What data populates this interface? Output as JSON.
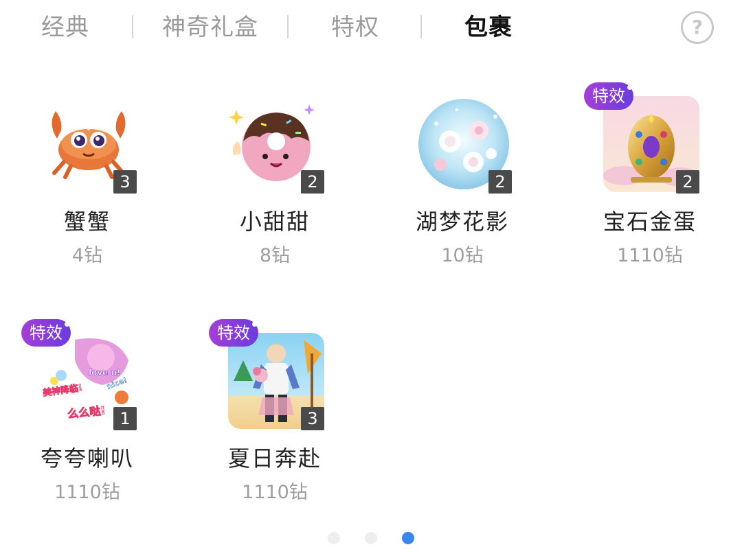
{
  "tabs": [
    {
      "label": "经典",
      "active": false
    },
    {
      "label": "神奇礼盒",
      "active": false
    },
    {
      "label": "特权",
      "active": false
    },
    {
      "label": "包裹",
      "active": true
    }
  ],
  "help_icon": "question-circle-icon",
  "effect_badge": "特效",
  "gifts": [
    {
      "name": "蟹蟹",
      "price": "4钻",
      "count": "3",
      "effect": false,
      "icon": "crab-icon"
    },
    {
      "name": "小甜甜",
      "price": "8钻",
      "count": "2",
      "effect": false,
      "icon": "donut-icon"
    },
    {
      "name": "湖梦花影",
      "price": "10钻",
      "count": "2",
      "effect": false,
      "icon": "flower-orb-icon"
    },
    {
      "name": "宝石金蛋",
      "price": "1110钻",
      "count": "2",
      "effect": true,
      "icon": "jeweled-egg-icon"
    },
    {
      "name": "夸夸喇叭",
      "price": "1110钻",
      "count": "1",
      "effect": true,
      "icon": "praise-horn-icon"
    },
    {
      "name": "夏日奔赴",
      "price": "1110钻",
      "count": "3",
      "effect": true,
      "icon": "summer-man-icon"
    }
  ],
  "horn_stickers": [
    "love u!",
    "nice!",
    "美神降临!",
    "么么哒!"
  ],
  "pager": {
    "pages": 3,
    "current": 3
  },
  "colors": {
    "accent": "#3a86f0",
    "effect_badge": "#8a3ddb",
    "count_bg": "#4a4a4a"
  }
}
